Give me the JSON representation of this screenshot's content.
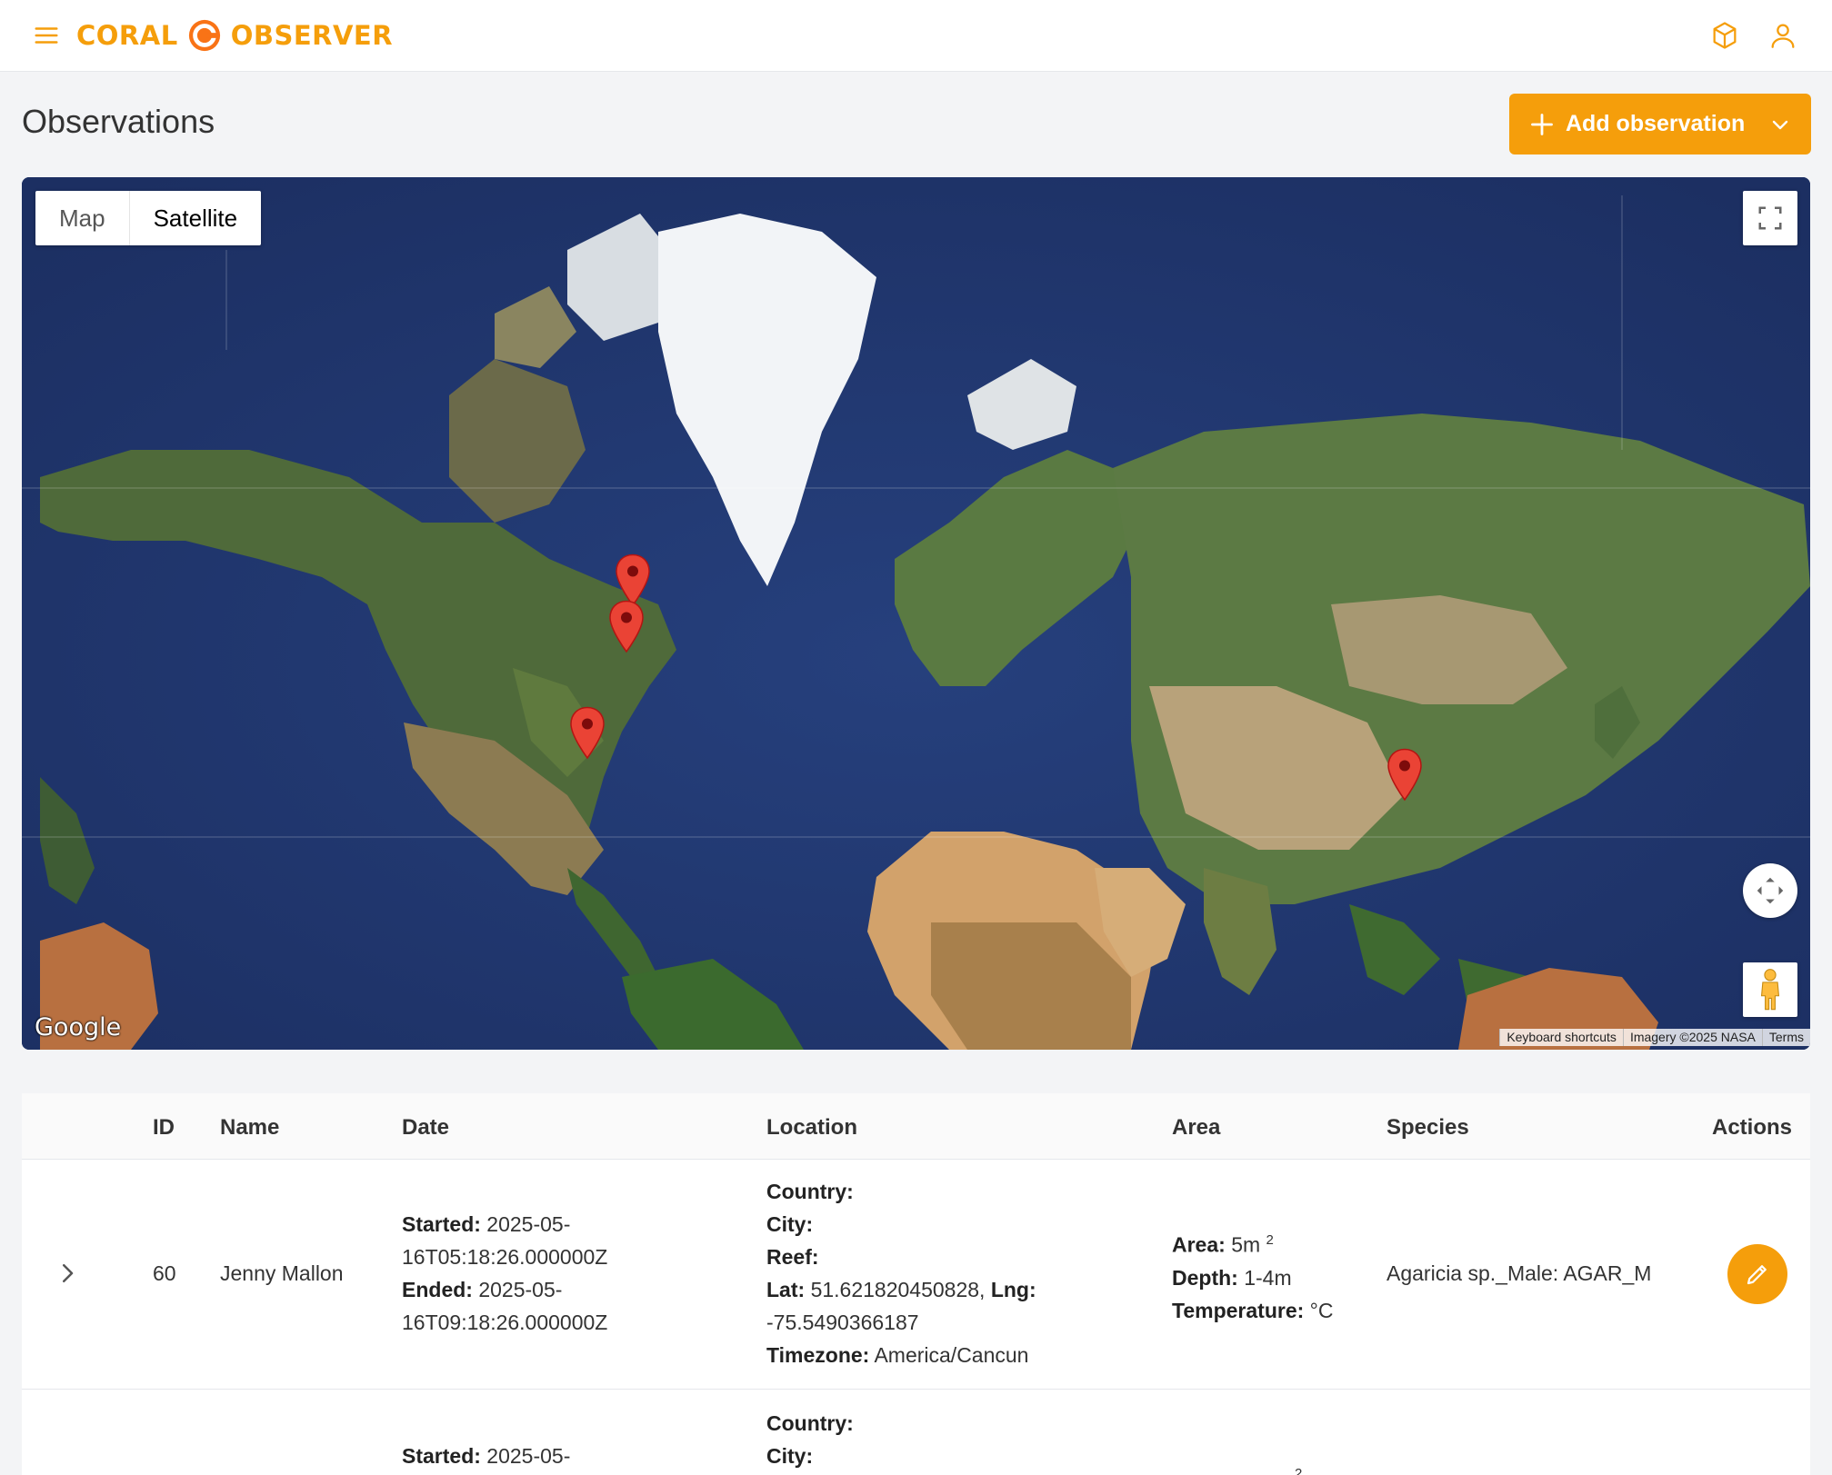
{
  "app": {
    "brand_left": "CORAL",
    "brand_right": "OBSERVER",
    "accent_color": "#f59e0b"
  },
  "header": {
    "menu_icon": "hamburger-icon",
    "icons": [
      "cube-icon",
      "user-icon"
    ]
  },
  "page": {
    "title": "Observations",
    "add_button_label": "Add observation"
  },
  "map": {
    "type_options": [
      "Map",
      "Satellite"
    ],
    "selected_type": "Satellite",
    "logo_text": "Google",
    "attribution": [
      "Keyboard shortcuts",
      "Imagery ©2025 NASA",
      "Terms"
    ],
    "markers": [
      {
        "name": "marker-hudson-bay"
      },
      {
        "name": "marker-great-lakes"
      },
      {
        "name": "marker-gulf-of-mexico"
      },
      {
        "name": "marker-south-china-sea"
      }
    ]
  },
  "table": {
    "columns": [
      "ID",
      "Name",
      "Date",
      "Location",
      "Area",
      "Species",
      "Actions"
    ],
    "rows": [
      {
        "id": "60",
        "name": "Jenny Mallon",
        "started_label": "Started:",
        "started_value_1": "2025-05-",
        "started_value_2": "16T05:18:26.000000Z",
        "ended_label": "Ended:",
        "ended_value_1": "2025-05-",
        "ended_value_2": "16T09:18:26.000000Z",
        "country_label": "Country:",
        "city_label": "City:",
        "reef_label": "Reef:",
        "lat_label": "Lat:",
        "lat_value": "51.621820450828,",
        "lng_label": "Lng:",
        "lng_value": "-75.5490366187",
        "timezone_label": "Timezone:",
        "timezone_value": "America/Cancun",
        "area_label": "Area:",
        "area_value": "5m",
        "area_unit_sup": "2",
        "depth_label": "Depth:",
        "depth_value": "1-4m",
        "temp_label": "Temperature:",
        "temp_value": "°C",
        "species": "Agaricia sp._Male: AGAR_M"
      },
      {
        "started_label": "Started:",
        "started_value_1": "2025-05-",
        "country_label": "Country:",
        "city_label": "City:",
        "area_unit_sup": "2"
      }
    ]
  }
}
